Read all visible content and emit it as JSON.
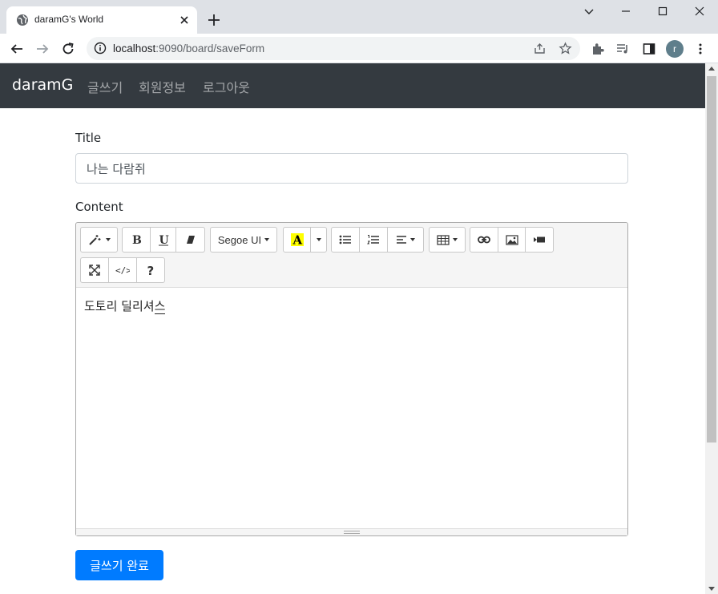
{
  "browser": {
    "tab_title": "daramG's World",
    "url_host": "localhost",
    "url_rest": ":9090/board/saveForm",
    "avatar_letter": "r"
  },
  "navbar": {
    "brand": "daramG",
    "links": [
      "글쓰기",
      "회원정보",
      "로그아웃"
    ]
  },
  "form": {
    "title_label": "Title",
    "title_value": "나는 다람쥐",
    "content_label": "Content",
    "editor": {
      "font_name": "Segoe UI",
      "content_text": "도토리 딜리셔",
      "content_cursor_char": "스",
      "highlight_color": "#ffff00"
    },
    "submit_label": "글쓰기 완료"
  },
  "colors": {
    "navbar_bg": "#343a40",
    "primary": "#007bff"
  }
}
